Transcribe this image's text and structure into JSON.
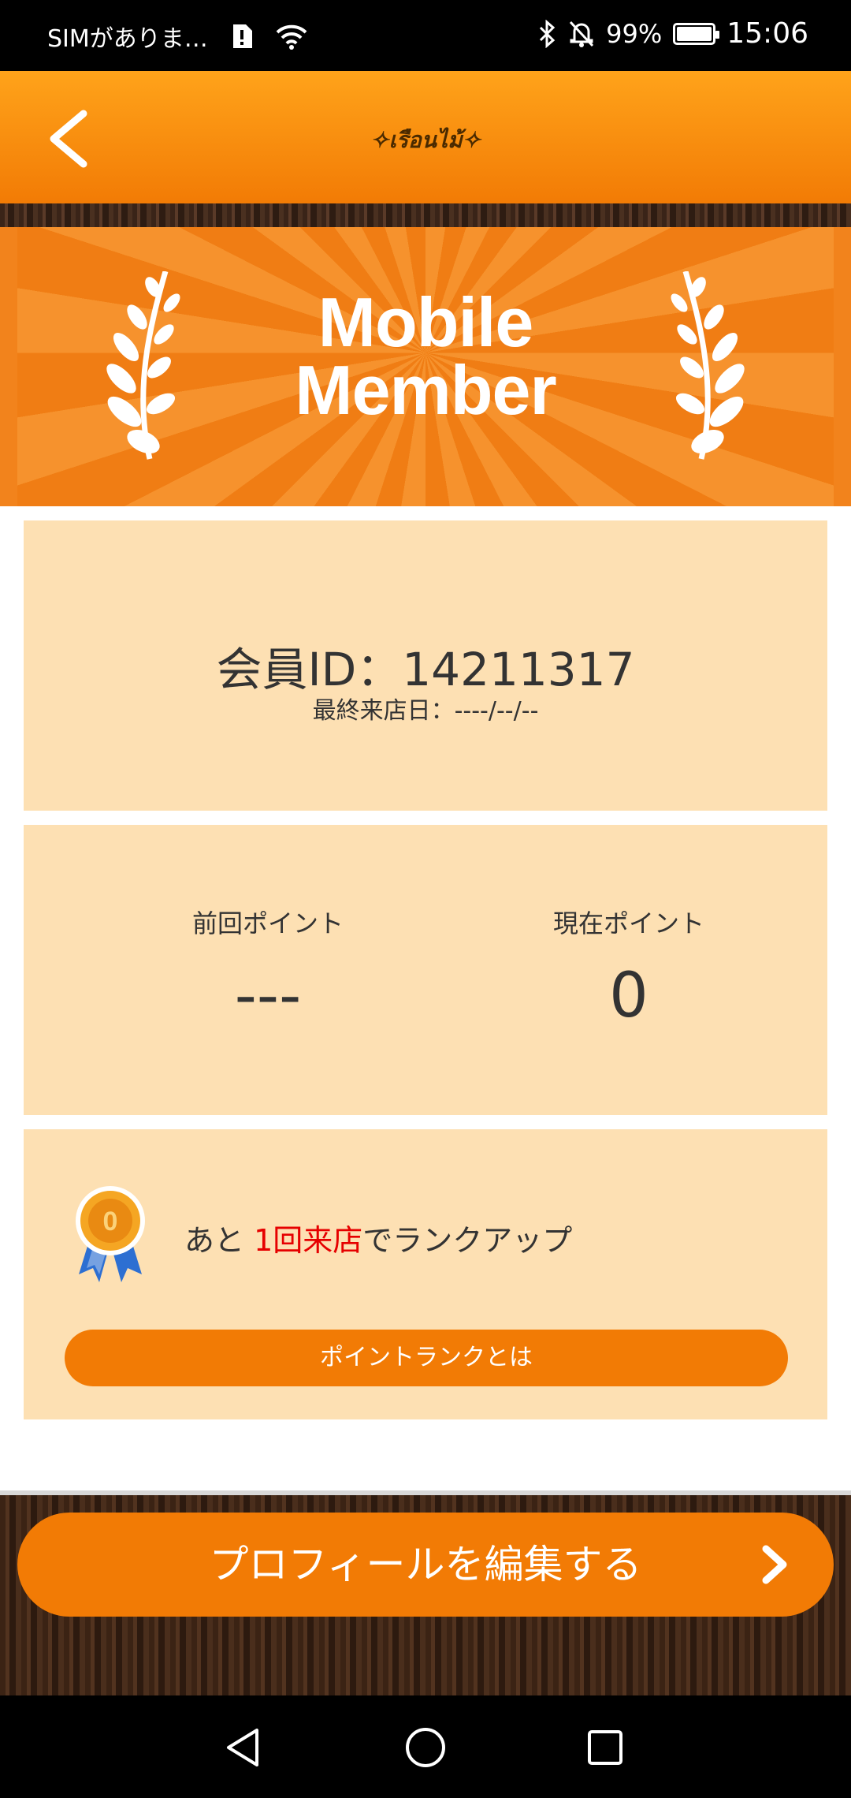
{
  "status_bar": {
    "carrier": "SIMがありま…",
    "battery_percent": "99%",
    "battery_level": 0.99,
    "time": "15:06",
    "icons": [
      "sim-alert-icon",
      "wifi-icon",
      "bluetooth-icon",
      "mute-bell-icon",
      "battery-icon"
    ]
  },
  "header": {
    "logo_text": "✧เรือนไม้✧",
    "back_icon": "chevron-left-icon"
  },
  "banner": {
    "title_line1": "Mobile",
    "title_line2": "Member",
    "decor_icon": "laurel-icon"
  },
  "member": {
    "id_text": "会員ID：14211317",
    "last_visit_text": "最終来店日：----/--/--"
  },
  "points": {
    "previous_label": "前回ポイント",
    "previous_value": "---",
    "current_label": "現在ポイント",
    "current_value": "0"
  },
  "rank": {
    "medal_icon": "medal-icon",
    "medal_number": "0",
    "text_prefix": "あと ",
    "text_highlight": "1回来店",
    "text_suffix": "でランクアップ",
    "highlight_color": "#e60000",
    "button_label": "ポイントランクとは"
  },
  "footer": {
    "edit_button_label": "プロフィールを編集する",
    "edit_icon": "chevron-right-icon"
  },
  "colors": {
    "accent": "#f27b05",
    "card_bg": "#fde0b3"
  },
  "navbar": {
    "icons": [
      "nav-back-icon",
      "nav-home-icon",
      "nav-recent-icon"
    ]
  }
}
